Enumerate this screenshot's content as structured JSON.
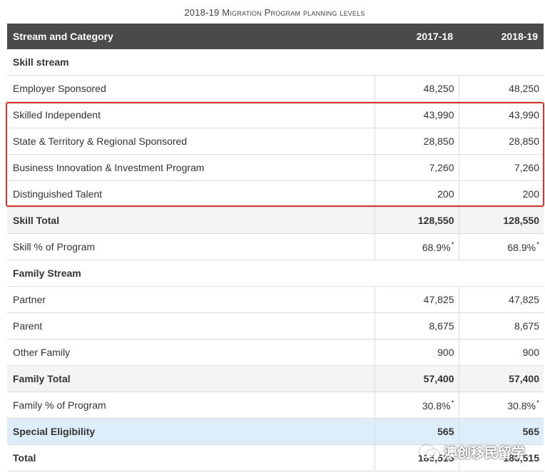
{
  "caption": "2018-19 Migration Program planning levels",
  "columns": [
    "Stream and Category",
    "2017-18",
    "2018-19"
  ],
  "rows": [
    {
      "label": "Skill stream",
      "v1": "",
      "v2": ""
    },
    {
      "label": "Employer Sponsored",
      "v1": "48,250",
      "v2": "48,250"
    },
    {
      "label": "Skilled Independent",
      "v1": "43,990",
      "v2": "43,990"
    },
    {
      "label": "State & Territory & Regional Sponsored",
      "v1": "28,850",
      "v2": "28,850"
    },
    {
      "label": "Business Innovation & Investment Program",
      "v1": "7,260",
      "v2": "7,260"
    },
    {
      "label": "Distinguished Talent",
      "v1": "200",
      "v2": "200"
    },
    {
      "label": "Skill Total",
      "v1": "128,550",
      "v2": "128,550"
    },
    {
      "label": "Skill % of Program",
      "v1": "68.9%",
      "v2": "68.9%"
    },
    {
      "label": "Family Stream",
      "v1": "",
      "v2": ""
    },
    {
      "label": "Partner",
      "v1": "47,825",
      "v2": "47,825"
    },
    {
      "label": "Parent",
      "v1": "8,675",
      "v2": "8,675"
    },
    {
      "label": "Other Family",
      "v1": "900",
      "v2": "900"
    },
    {
      "label": "Family Total",
      "v1": "57,400",
      "v2": "57,400"
    },
    {
      "label": "Family % of Program",
      "v1": "30.8%",
      "v2": "30.8%"
    },
    {
      "label": "Special Eligibility",
      "v1": "565",
      "v2": "565"
    },
    {
      "label": "Total",
      "v1": "186,515",
      "v2": "186,515"
    }
  ],
  "footnote_marker": "*",
  "watermark": "澳创移民留学",
  "colors": {
    "header_bg": "#4a4a4a",
    "highlight_bg": "#ddeefa",
    "total_bg": "#f4f4f4",
    "red_box": "#d9342b"
  }
}
